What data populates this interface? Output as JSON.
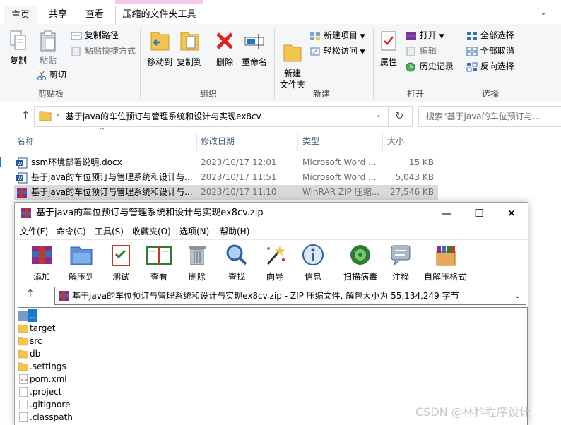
{
  "ribbon": {
    "tabs": [
      "主页",
      "共享",
      "查看",
      "压缩的文件夹工具"
    ],
    "groups": {
      "clipboard": {
        "label": "剪贴板",
        "copy": "复制",
        "paste": "粘贴",
        "copy_path": "复制路径",
        "paste_shortcut": "粘贴快捷方式",
        "cut": "剪切"
      },
      "organize": {
        "label": "组织",
        "move_to": "移动到",
        "copy_to": "复制到",
        "delete": "删除",
        "rename": "重命名"
      },
      "new": {
        "label": "新建",
        "new_folder": "新建\n文件夹",
        "new_item": "新建项目",
        "easy_access": "轻松访问"
      },
      "open": {
        "label": "打开",
        "properties": "属性",
        "open": "打开",
        "edit": "编辑",
        "history": "历史记录"
      },
      "select": {
        "label": "选择",
        "select_all": "全部选择",
        "select_none": "全部取消",
        "invert": "反向选择"
      }
    }
  },
  "address": {
    "path": "基于java的车位预订与管理系统和设计与实现ex8cv",
    "search_placeholder": "搜索\"基于java的车位预订与..."
  },
  "file_list": {
    "columns": [
      "名称",
      "修改日期",
      "类型",
      "大小"
    ],
    "rows": [
      {
        "name": "ssm环境部署说明.docx",
        "date": "2023/10/17 12:01",
        "type": "Microsoft Word ...",
        "size": "15 KB",
        "icon": "word-doc-icon"
      },
      {
        "name": "基于java的车位预订与管理系统和设计与...",
        "date": "2023/10/17 11:51",
        "type": "Microsoft Word ...",
        "size": "5,043 KB",
        "icon": "word-doc-icon"
      },
      {
        "name": "基于java的车位预订与管理系统和设计与...",
        "date": "2023/10/17 11:10",
        "type": "WinRAR ZIP 压缩...",
        "size": "27,546 KB",
        "icon": "winrar-archive-icon",
        "selected": true
      }
    ]
  },
  "winrar": {
    "title": "基于java的车位预订与管理系统和设计与实现ex8cv.zip",
    "menu": [
      "文件(F)",
      "命令(C)",
      "工具(S)",
      "收藏夹(O)",
      "选项(N)",
      "帮助(H)"
    ],
    "toolbar": [
      "添加",
      "解压到",
      "测试",
      "查看",
      "删除",
      "查找",
      "向导",
      "信息",
      "扫描病毒",
      "注释",
      "自解压格式"
    ],
    "path_info": "基于java的车位预订与管理系统和设计与实现ex8cv.zip - ZIP 压缩文件, 解包大小为 55,134,249 字节",
    "entries": [
      {
        "name": "..",
        "kind": "up"
      },
      {
        "name": "target",
        "kind": "folder"
      },
      {
        "name": "src",
        "kind": "folder"
      },
      {
        "name": "db",
        "kind": "folder"
      },
      {
        "name": ".settings",
        "kind": "folder"
      },
      {
        "name": "pom.xml",
        "kind": "xml"
      },
      {
        "name": ".project",
        "kind": "file"
      },
      {
        "name": ".gitignore",
        "kind": "file"
      },
      {
        "name": ".classpath",
        "kind": "file"
      }
    ]
  },
  "watermark": "CSDN @林科程序设计",
  "colors": {
    "accent": "#1979ca",
    "selection": "#d9d9d9",
    "context_tab": "#f5c7e9",
    "folder": "#f3c54e"
  }
}
